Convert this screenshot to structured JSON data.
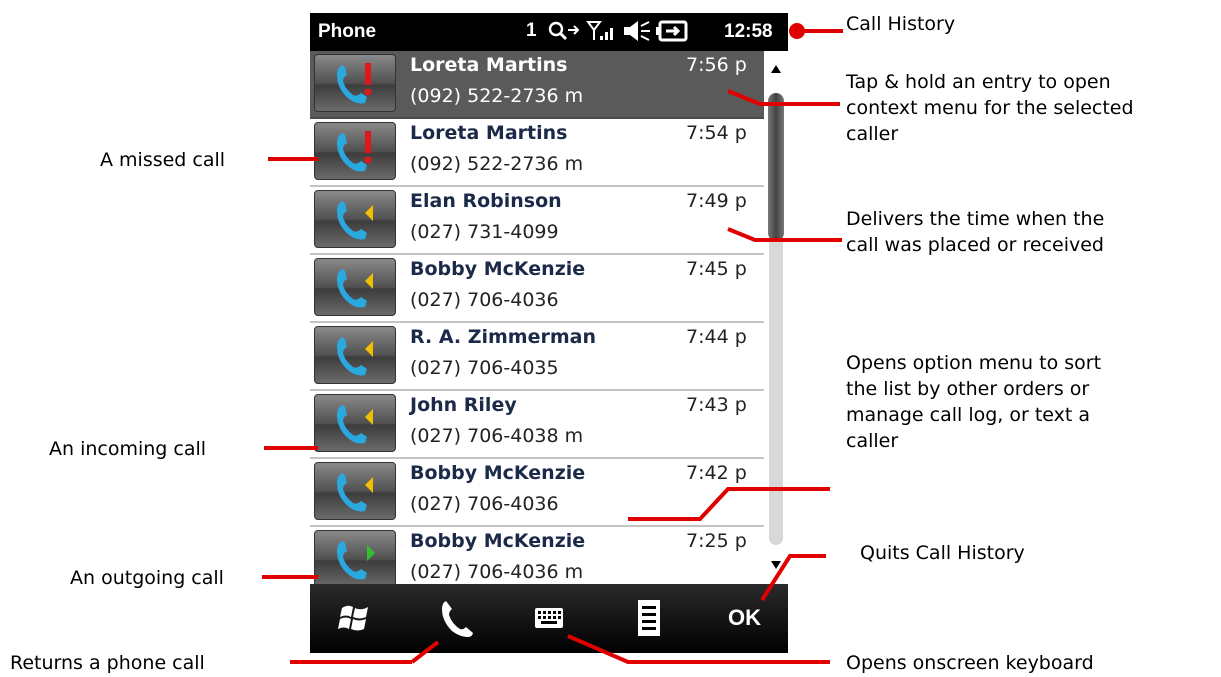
{
  "phone": {
    "app_title": "Phone",
    "status_signal_count": "1",
    "clock": "12:58",
    "softkey_ok": "OK"
  },
  "calls": [
    {
      "name": "Loreta Martins",
      "number": "(092) 522-2736 m",
      "time": "7:56 p",
      "type": "missed",
      "selected": true
    },
    {
      "name": "Loreta Martins",
      "number": "(092) 522-2736 m",
      "time": "7:54 p",
      "type": "missed",
      "selected": false
    },
    {
      "name": "Elan Robinson",
      "number": "(027) 731-4099",
      "time": "7:49 p",
      "type": "incoming",
      "selected": false
    },
    {
      "name": "Bobby McKenzie",
      "number": "(027) 706-4036",
      "time": "7:45 p",
      "type": "incoming",
      "selected": false
    },
    {
      "name": "R. A. Zimmerman",
      "number": "(027) 706-4035",
      "time": "7:44 p",
      "type": "incoming",
      "selected": false
    },
    {
      "name": "John Riley",
      "number": "(027) 706-4038 m",
      "time": "7:43 p",
      "type": "incoming",
      "selected": false
    },
    {
      "name": "Bobby McKenzie",
      "number": "(027) 706-4036",
      "time": "7:42 p",
      "type": "incoming",
      "selected": false
    },
    {
      "name": "Bobby McKenzie",
      "number": "(027) 706-4036 m",
      "time": "7:25 p",
      "type": "outgoing",
      "selected": false
    }
  ],
  "annotations": {
    "call_history": "Call History",
    "tap_hold_1": "Tap & hold an entry to open",
    "tap_hold_2": "context menu for the selected",
    "tap_hold_3": "caller",
    "missed": "A missed call",
    "delivers_1": "Delivers the time when the",
    "delivers_2": "call was placed or received",
    "options_1": "Opens option menu to sort",
    "options_2": "the list by other orders or",
    "options_3": "manage call log, or text a",
    "options_4": "caller",
    "incoming": "An incoming call",
    "quits": "Quits Call History",
    "outgoing": "An outgoing call",
    "returns": "Returns a phone call",
    "keyboard": "Opens onscreen keyboard"
  },
  "colors": {
    "pointer": "#e00000",
    "name_text": "#1c2a4a",
    "selected_row": "#5a5a5a",
    "handset_blue": "#2aa8e0",
    "missed_red": "#e01818",
    "incoming_yellow": "#f0c000",
    "outgoing_green": "#30c030"
  },
  "icons": {
    "missed": "phone-missed-icon",
    "incoming": "phone-incoming-icon",
    "outgoing": "phone-outgoing-icon",
    "start": "windows-start-icon",
    "talk": "phone-handset-icon",
    "keyboard": "keyboard-icon",
    "menu": "menu-list-icon"
  }
}
